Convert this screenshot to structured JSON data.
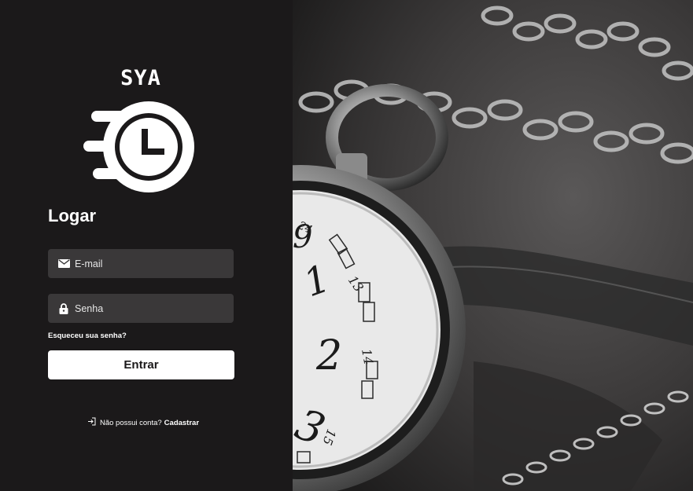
{
  "brand": {
    "name": "SYA"
  },
  "login": {
    "title": "Logar",
    "email": {
      "placeholder": "E-mail",
      "icon": "envelope-icon"
    },
    "password": {
      "placeholder": "Senha",
      "icon": "lock-icon"
    },
    "forgot_label": "Esqueceu sua senha?",
    "submit_label": "Entrar",
    "signup_question": "Não possui conta?",
    "signup_link": "Cadastrar",
    "signup_icon": "sign-in-icon"
  },
  "hero": {
    "icon": "pocket-watch-photo"
  },
  "colors": {
    "panel": "#1b191a",
    "field": "#3a3839",
    "button": "#ffffff",
    "button_text": "#1b191a"
  }
}
